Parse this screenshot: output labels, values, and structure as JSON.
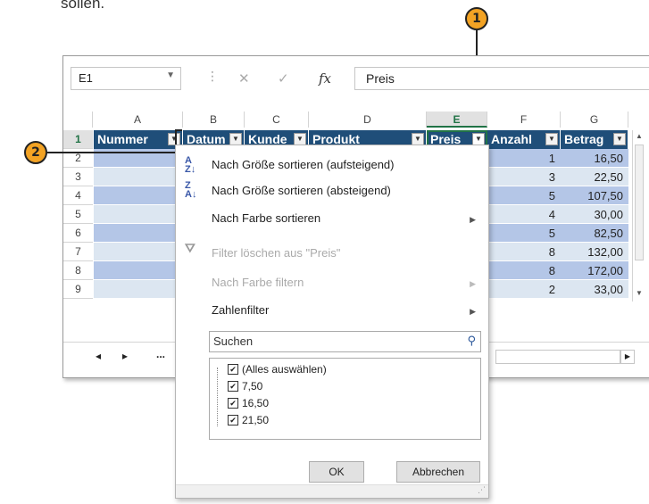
{
  "caption_fragment": "sollen.",
  "callouts": {
    "one": "1",
    "two": "2"
  },
  "formula_bar": {
    "name_box": "E1",
    "cancel_symbol": "✕",
    "enter_symbol": "✓",
    "fx_symbol": "fx",
    "formula_value": "Preis"
  },
  "columns": [
    "A",
    "B",
    "C",
    "D",
    "E",
    "F",
    "G"
  ],
  "rows": [
    "1",
    "2",
    "3",
    "4",
    "5",
    "6",
    "7",
    "8",
    "9"
  ],
  "table_headers": [
    "Nummer",
    "Datum",
    "Kunde",
    "Produkt",
    "Preis",
    "Anzahl",
    "Betrag"
  ],
  "anzahl_values": [
    "1",
    "3",
    "5",
    "4",
    "5",
    "8",
    "8",
    "2"
  ],
  "betrag_values": [
    "16,50",
    "22,50",
    "107,50",
    "30,00",
    "82,50",
    "132,00",
    "172,00",
    "33,00"
  ],
  "sheet_nav": {
    "prev": "◂",
    "next": "▸",
    "more": "..."
  },
  "filter_menu": {
    "sort_asc": "Nach Größe sortieren (aufsteigend)",
    "sort_desc": "Nach Größe sortieren (absteigend)",
    "sort_color": "Nach Farbe sortieren",
    "clear_filter": "Filter löschen aus \"Preis\"",
    "filter_color": "Nach Farbe filtern",
    "number_filter": "Zahlenfilter",
    "search_placeholder": "Suchen",
    "list_items": [
      "(Alles auswählen)",
      "7,50",
      "16,50",
      "21,50"
    ],
    "ok_label": "OK",
    "cancel_label": "Abbrechen"
  }
}
